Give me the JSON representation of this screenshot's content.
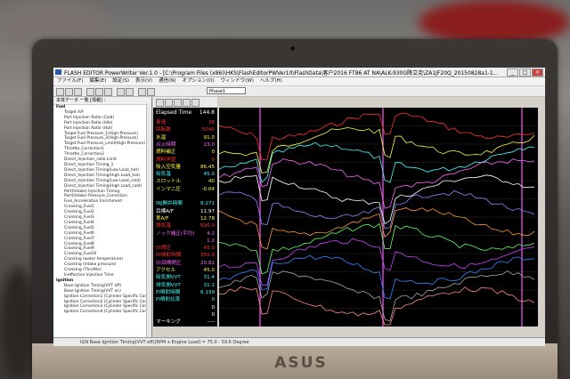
{
  "window": {
    "title": "FLASH EDITOR PowerWriter Ver.1.0 - [C:\\Program Files (x86)\\HKS\\FlashEditorPWVer10\\FlashData\\客户2016 FT86 AT NA\\ALK-930G降立克\\ZA1JF20Q_20150828a1-1...",
    "buttons": [
      "_",
      "□",
      "×"
    ]
  },
  "menu": [
    "ファイル(F)",
    "編集(E)",
    "設定(S)",
    "表示(V)",
    "通信(N)",
    "オプション(O)",
    "ウィンドウ(W)",
    "ヘルプ(H)"
  ],
  "toolbar": {
    "dropdown": "Phase1"
  },
  "tree": {
    "header": "本体データ 一覧 [情報] :",
    "fuel_items": [
      "Fuel",
      "Target A/F",
      "Port Injection Ratio (Cold)",
      "Port Injection Ratio (Idle)",
      "Port Injection Ratio (Hot)",
      "Target Fuel Pressure_1(High-Pressure)",
      "Target Fuel Pressure_2(High-Pressure)",
      "Target Fuel Pressure_Limit(High-Pressure)",
      "Throttle_Correction1",
      "Throttle_Correction2",
      "Direct_Injection_ratio Limit",
      "Direct_Injection Timing_1",
      "Direct_Injection Timing(Low Load_hot)",
      "Direct_Injection Timing(High Load_hot)",
      "Direct_Injection Timing(Low Load_cold)",
      "Direct_Injection Timing(High Load_cold)",
      "Port(Intake) Injection Timing",
      "Port(Intake) Pressure_Correction",
      "Fuel_Acceleration Enrichment",
      "Cranking_Fuel1",
      "Cranking_Fuel2",
      "Cranking_Fuel3",
      "Cranking_Fuel4",
      "Cranking_Fuel5",
      "Cranking_Fuel6",
      "Cranking_Fuel7",
      "Cranking_Fuel8",
      "Cranking_Fuel9",
      "Cranking_Fuel10",
      "Cranking (water temperature)",
      "Cranking (intake pressure)",
      "Cranking (Throttle)",
      "Ineffective Injection Time"
    ],
    "ignition_items": [
      "Ignition",
      "Base Ignition Timing(VVT off)",
      "Base Ignition Timing(VVT on)",
      "Ignition Correction1 (Cylinder Specific Cor...",
      "Ignition Correction2 (Cylinder Specific Cor...",
      "Ignition Correction3 (Cylinder Specific Cor...",
      "Ignition Correction4 (Cylinder Specific Cor..."
    ]
  },
  "datalog": {
    "elapsed_label": "Elapsed Time",
    "elapsed_value": "144.8",
    "rows": [
      {
        "label": "車速",
        "value": "38",
        "color": "#ff3333"
      },
      {
        "label": "回転数",
        "value": "5040",
        "color": "#ff3333"
      },
      {
        "label": "水温",
        "value": "91.0",
        "color": "#ffff44"
      },
      {
        "label": "点火時期",
        "value": "23.0",
        "color": "#ff66ff"
      },
      {
        "label": "燃料補正",
        "value": "0",
        "color": "#ffff44"
      },
      {
        "label": "燃料学習",
        "value": "0",
        "color": "#ff3333"
      },
      {
        "label": "吸入空気量",
        "value": "86.45",
        "color": "#ffff44"
      },
      {
        "label": "吸気温",
        "value": "45.0",
        "color": "#44ffff"
      },
      {
        "label": "スロットル",
        "value": "40",
        "color": "#ffff44"
      },
      {
        "label": "インマニ圧",
        "value": "-0.04",
        "color": "#ffff44"
      },
      {
        "label": "",
        "value": "",
        "color": "#ffffff"
      },
      {
        "label": "INJ開弁時間",
        "value": "8.271",
        "color": "#44ffff"
      },
      {
        "label": "目標A/F",
        "value": "11.97",
        "color": "#ffffff"
      },
      {
        "label": "実A/F",
        "value": "12.78",
        "color": "#ffff44"
      },
      {
        "label": "排気温",
        "value": "500.0",
        "color": "#ff3333"
      },
      {
        "label": "ノック補正(平均)",
        "value": "4.2",
        "color": "#ff66ff"
      },
      {
        "label": "",
        "value": "1.2",
        "color": "#ff66ff"
      },
      {
        "label": "DI燃圧",
        "value": "45.0",
        "color": "#ff3333"
      },
      {
        "label": "DI噴射時間",
        "value": "350.9",
        "color": "#ff3333"
      },
      {
        "label": "DI目標燃圧",
        "value": "20.82",
        "color": "#ff66ff"
      },
      {
        "label": "アクセル",
        "value": "45.0",
        "color": "#ffff44"
      },
      {
        "label": "吸気側VVT",
        "value": "31.4",
        "color": "#44ffff"
      },
      {
        "label": "排気側VVT",
        "value": "31.1",
        "color": "#44ffff"
      },
      {
        "label": "PI噴射時間",
        "value": "6.139",
        "color": "#44ffff"
      },
      {
        "label": "PI噴射比率",
        "value": "0",
        "color": "#44ffff"
      },
      {
        "label": "",
        "value": "0",
        "color": "#ffffff"
      },
      {
        "label": "",
        "value": "0",
        "color": "#ffffff"
      },
      {
        "label": "マーキング",
        "value": "----",
        "color": "#ffffff"
      }
    ]
  },
  "graph": {
    "series_colors": [
      "#ff3333",
      "#ffff44",
      "#44ffff",
      "#ff66ff",
      "#ffffff",
      "#8888ff",
      "#ff9933",
      "#66ff66",
      "#cc44ff",
      "#3388ff",
      "#aaaaaa",
      "#ff8888"
    ]
  },
  "status": {
    "text": "IGN  Base Ignition Timing(VVT off)[RPM x Engine Load] = 75.0 - 59.6 Degree"
  },
  "brand": "ASUS"
}
